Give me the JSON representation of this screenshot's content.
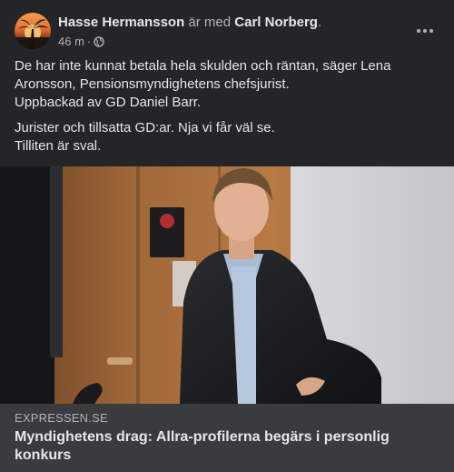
{
  "post": {
    "author": "Hasse Hermansson",
    "with_text": "är med",
    "tagged": "Carl Norberg",
    "after_tag": ".",
    "time": "46 m",
    "separator": "·",
    "privacy_icon": "globe-icon",
    "more_icon": "more-options-icon",
    "text": {
      "line1": "De har inte kunnat betala hela skulden och räntan, säger Lena",
      "line2": "Aronsson, Pensionsmyndighetens chefsjurist.",
      "line3": "Uppbackad av GD Daniel Barr.",
      "line4": "Jurister och tillsatta GD:ar. Nja vi får väl se.",
      "line5": "Tilliten är sval."
    }
  },
  "link_preview": {
    "domain": "EXPRESSEN.SE",
    "title": "Myndighetens drag: Allra-profilerna begärs i personlig konkurs"
  },
  "colors": {
    "card_bg": "#242526",
    "link_bg": "#3a3b3c",
    "text_primary": "#e4e6eb",
    "text_secondary": "#b0b3b8"
  }
}
